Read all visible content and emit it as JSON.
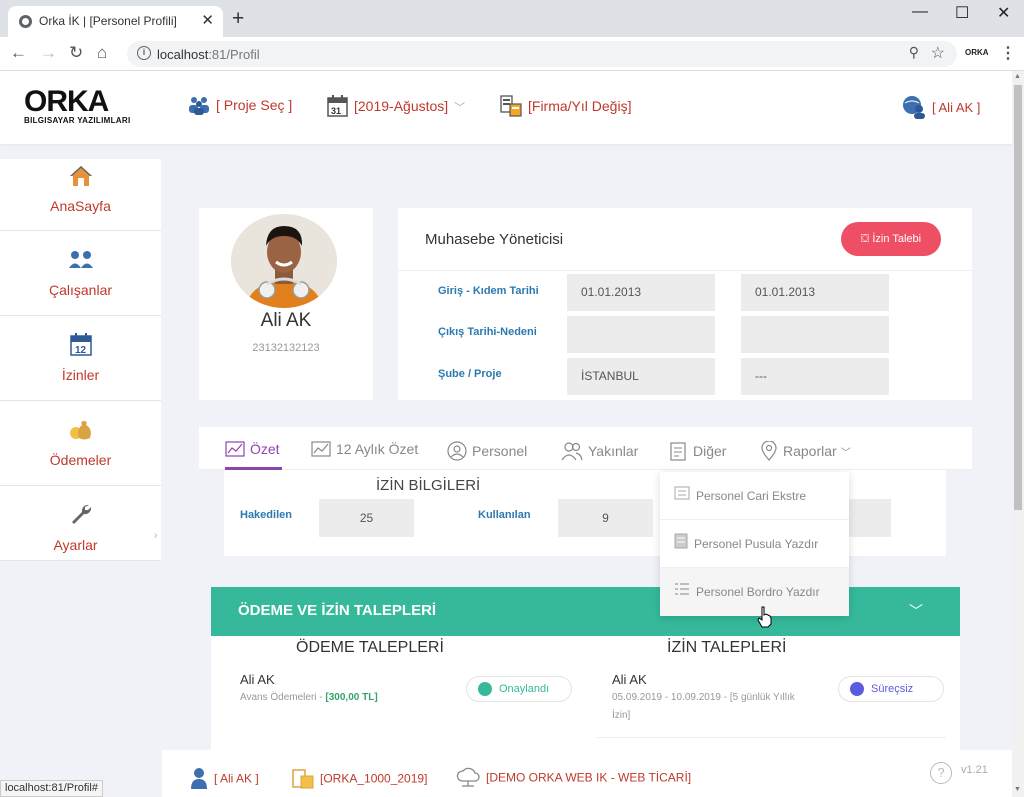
{
  "browser": {
    "tab_title": "Orka İK | [Personel Profili]",
    "url_host": "localhost",
    "url_rest": ":81/Profil",
    "ext_label": "ORKA",
    "status_url": "localhost:81/Profil#"
  },
  "header": {
    "logo_main": "ORKA",
    "logo_sub": "BILGISAYAR YAZILIMLARI",
    "proje": "[ Proje Seç ]",
    "period": "[2019-Ağustos]",
    "firma": "[Firma/Yıl Değiş]",
    "user": "[ Ali AK ]"
  },
  "sidebar": {
    "items": [
      {
        "label": "AnaSayfa",
        "icon": "home-icon"
      },
      {
        "label": "Çalışanlar",
        "icon": "users-icon"
      },
      {
        "label": "İzinler",
        "icon": "calendar-icon"
      },
      {
        "label": "Ödemeler",
        "icon": "money-bag-icon"
      },
      {
        "label": "Ayarlar",
        "icon": "wrench-icon"
      }
    ]
  },
  "profile": {
    "name": "Ali AK",
    "id": "23132132123"
  },
  "info": {
    "title": "Muhasebe Yöneticisi",
    "izin_button": "İzin Talebi",
    "rows": [
      {
        "label": "Giriş - Kıdem Tarihi",
        "v1": "01.01.2013",
        "v2": "01.01.2013"
      },
      {
        "label": "Çıkış Tarihi-Nedeni",
        "v1": "",
        "v2": ""
      },
      {
        "label": "Şube / Proje",
        "v1": "İSTANBUL",
        "v2": "---"
      }
    ]
  },
  "tabs": [
    {
      "label": "Özet",
      "icon": "chart-icon",
      "active": true
    },
    {
      "label": "12 Aylık Özet",
      "icon": "chart-icon"
    },
    {
      "label": "Personel",
      "icon": "person-icon"
    },
    {
      "label": "Yakınlar",
      "icon": "people-icon"
    },
    {
      "label": "Diğer",
      "icon": "document-icon"
    },
    {
      "label": "Raporlar",
      "icon": "location-icon"
    }
  ],
  "izin_bilgileri": {
    "title": "İZİN BİLGİLERİ",
    "hakedilen_label": "Hakedilen",
    "hakedilen_value": "25",
    "kullanilan_label": "Kullanılan",
    "kullanilan_value": "9"
  },
  "dropdown": {
    "items": [
      {
        "label": "Personel Cari Ekstre"
      },
      {
        "label": "Personel Pusula Yazdır"
      },
      {
        "label": "Personel Bordro Yazdır"
      }
    ]
  },
  "requests": {
    "banner": "ÖDEME VE İZİN TALEPLERİ",
    "odeme_title": "ÖDEME TALEPLERİ",
    "izin_title": "İZİN TALEPLERİ",
    "odeme": {
      "name": "Ali AK",
      "desc": "Avans Ödemeleri - ",
      "amount": "[300,00 TL]",
      "status": "Onaylandı",
      "status_color": "#35b99a"
    },
    "izin": {
      "name": "Ali AK",
      "desc1": "05.09.2019 - 10.09.2019 - [5 günlük Yıllık",
      "desc2": "İzin]",
      "status": "Süreçsiz",
      "status_color": "#5b5be0"
    }
  },
  "footer": {
    "user": "[ Ali AK ]",
    "company": "[ORKA_1000_2019]",
    "demo": "[DEMO ORKA WEB IK - WEB TİCARİ]",
    "version": "v1.21"
  },
  "colors": {
    "accent_red": "#c0392b",
    "accent_purple": "#8e44ad",
    "green": "#35b99a",
    "pink_button": "#ee4f64"
  }
}
